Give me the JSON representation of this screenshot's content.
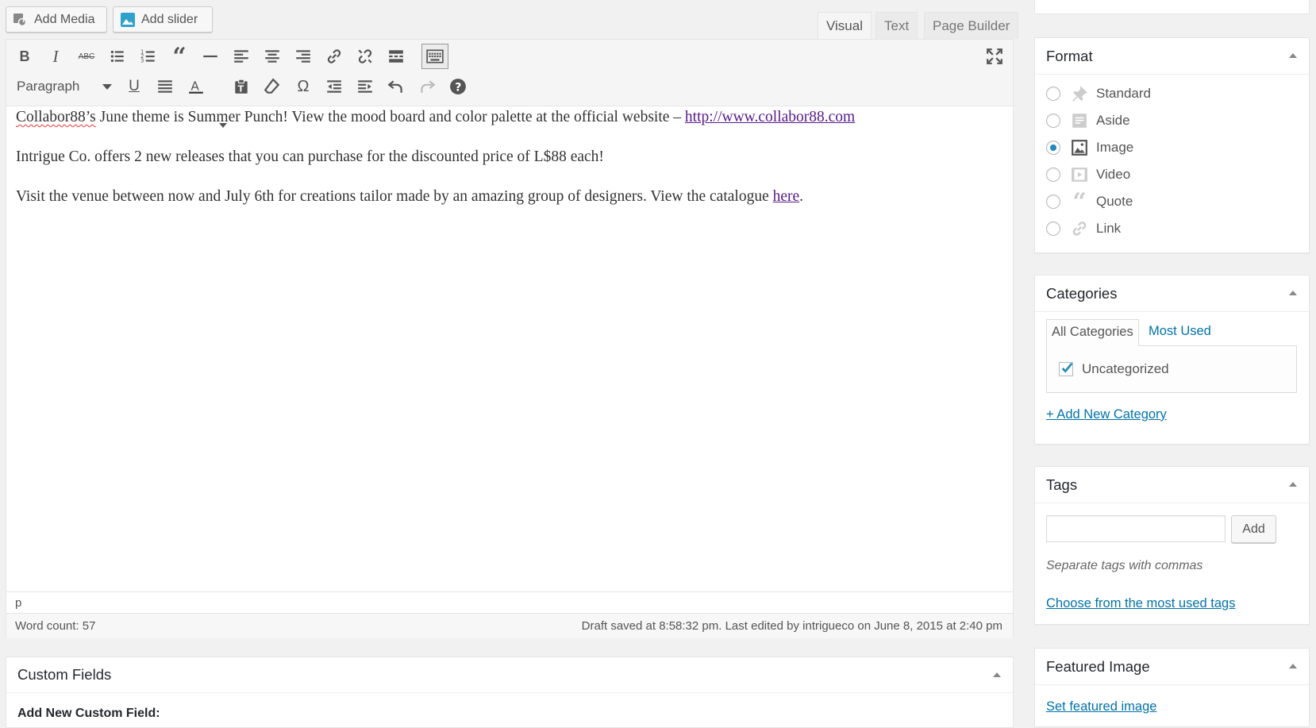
{
  "colors": {
    "accent": "#0073aa",
    "link_visited": "#551a8b",
    "primary_button": "#0085ba"
  },
  "media_buttons": {
    "add_media": "Add Media",
    "add_slider": "Add slider"
  },
  "editor_tabs": [
    "Visual",
    "Text",
    "Page Builder"
  ],
  "toolbar": {
    "row1_icons": [
      "bold-icon",
      "italic-icon",
      "strikethrough-icon",
      "bulleted-list-icon",
      "numbered-list-icon",
      "blockquote-icon",
      "horizontal-line-icon",
      "align-left-icon",
      "align-center-icon",
      "align-right-icon",
      "insert-link-icon",
      "remove-link-icon",
      "read-more-icon",
      "toolbar-toggle-icon",
      "fullscreen-icon"
    ],
    "row2_icons": [
      "underline-icon",
      "justify-icon",
      "text-color-icon",
      "paste-as-text-icon",
      "clear-formatting-icon",
      "special-character-icon",
      "outdent-icon",
      "indent-icon",
      "undo-icon",
      "redo-icon",
      "help-icon"
    ],
    "format_select": "Paragraph"
  },
  "content": {
    "p1": {
      "word": "Collabor88’s",
      "text": " June theme is Summer Punch! View the mood board and color palette at the official website – ",
      "link": "http://www.collabor88.com"
    },
    "p2": "Intrigue Co. offers 2 new releases that you can purchase for the discounted price of L$88 each!",
    "p3": {
      "text": "Visit the venue between now and July 6th for creations tailor made by an amazing group of designers. View the catalogue ",
      "link": "here",
      "after": "."
    }
  },
  "path": "p",
  "status": {
    "word_count": "Word count: 57",
    "draft": "Draft saved at 8:58:32 pm. Last edited by intrigueco on June 8, 2015 at 2:40 pm"
  },
  "custom_fields": {
    "title": "Custom Fields",
    "add_new": "Add New Custom Field:"
  },
  "format": {
    "title": "Format",
    "options": [
      {
        "label": "Standard",
        "icon": "pin-icon",
        "selected": false
      },
      {
        "label": "Aside",
        "icon": "aside-icon",
        "selected": false
      },
      {
        "label": "Image",
        "icon": "image-icon",
        "selected": true
      },
      {
        "label": "Video",
        "icon": "video-icon",
        "selected": false
      },
      {
        "label": "Quote",
        "icon": "quote-icon",
        "selected": false
      },
      {
        "label": "Link",
        "icon": "link-icon",
        "selected": false
      }
    ]
  },
  "categories": {
    "title": "Categories",
    "tab_all": "All Categories",
    "tab_most_used": "Most Used",
    "items": [
      {
        "label": "Uncategorized",
        "checked": true
      }
    ],
    "add_new": "+ Add New Category"
  },
  "tags": {
    "title": "Tags",
    "input_value": "",
    "add_button": "Add",
    "hint": "Separate tags with commas",
    "choose_link": "Choose from the most used tags"
  },
  "featured_image": {
    "title": "Featured Image",
    "set_link": "Set featured image"
  }
}
